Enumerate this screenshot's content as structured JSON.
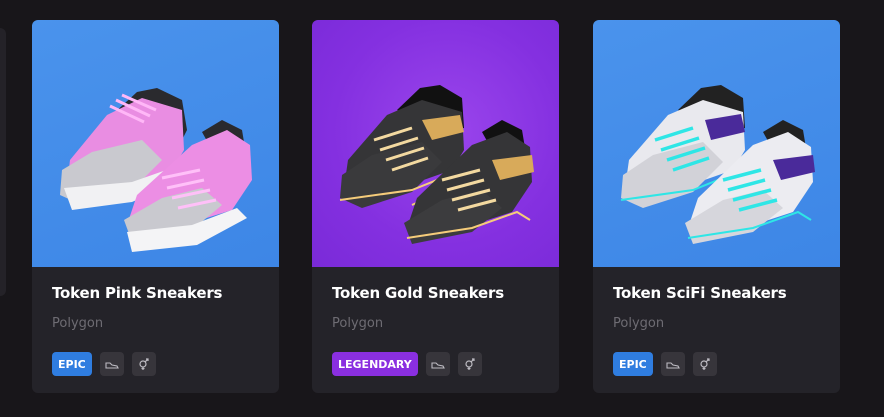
{
  "cards": [
    {
      "title": "Token Pink Sneakers",
      "chain": "Polygon",
      "rarity": "EPIC",
      "rarity_color": "#2f7de0",
      "background": "#4a93ec",
      "icons": [
        "shoe-icon",
        "gender-icon"
      ]
    },
    {
      "title": "Token Gold Sneakers",
      "chain": "Polygon",
      "rarity": "LEGENDARY",
      "rarity_color": "#8a2fe0",
      "background": "#8a35e4",
      "icons": [
        "shoe-icon",
        "gender-icon"
      ]
    },
    {
      "title": "Token SciFi Sneakers",
      "chain": "Polygon",
      "rarity": "EPIC",
      "rarity_color": "#2f7de0",
      "background": "#4a93ec",
      "icons": [
        "shoe-icon",
        "gender-icon"
      ]
    }
  ]
}
